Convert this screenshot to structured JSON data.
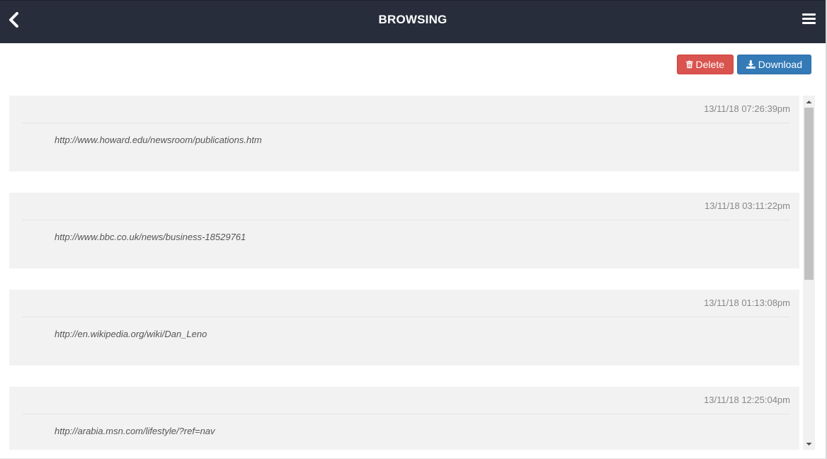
{
  "header": {
    "title": "BROWSING",
    "back_icon": "chevron-left-icon",
    "menu_icon": "hamburger-menu-icon",
    "background": "#282d3b"
  },
  "toolbar": {
    "delete_label": "Delete",
    "delete_icon": "trash-icon",
    "delete_color": "#d9534f",
    "download_label": "Download",
    "download_icon": "download-icon",
    "download_color": "#337ab7"
  },
  "history": [
    {
      "timestamp": "13/11/18 07:26:39pm",
      "url": "http://www.howard.edu/newsroom/publications.htm"
    },
    {
      "timestamp": "13/11/18 03:11:22pm",
      "url": "http://www.bbc.co.uk/news/business-18529761"
    },
    {
      "timestamp": "13/11/18 01:13:08pm",
      "url": "http://en.wikipedia.org/wiki/Dan_Leno"
    },
    {
      "timestamp": "13/11/18 12:25:04pm",
      "url": "http://arabia.msn.com/lifestyle/?ref=nav"
    }
  ]
}
